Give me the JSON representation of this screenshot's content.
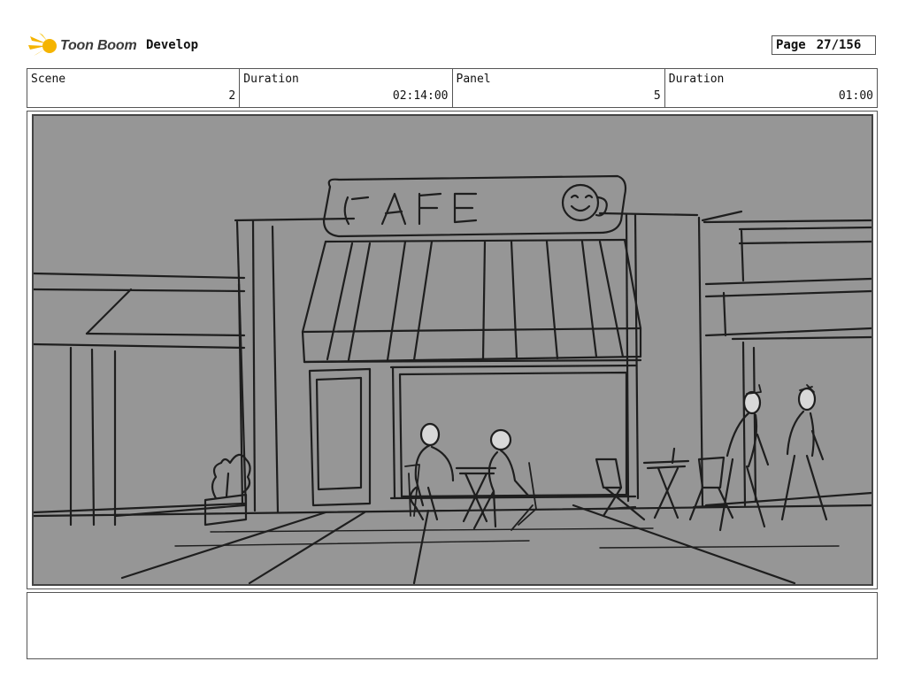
{
  "header": {
    "logo_text": "Toon Boom",
    "project_name": "Develop",
    "page_label": "Page",
    "page_value": "27/156"
  },
  "info": {
    "scene_label": "Scene",
    "scene_value": "2",
    "scene_duration_label": "Duration",
    "scene_duration_value": "02:14:00",
    "panel_label": "Panel",
    "panel_value": "5",
    "panel_duration_label": "Duration",
    "panel_duration_value": "01:00"
  },
  "panel": {
    "sign_text": "CAFE"
  },
  "notes": {
    "text": ""
  },
  "colors": {
    "sketch_bg": "#969696",
    "ink": "#1e1e1e",
    "logo_yellow": "#f5b400"
  }
}
